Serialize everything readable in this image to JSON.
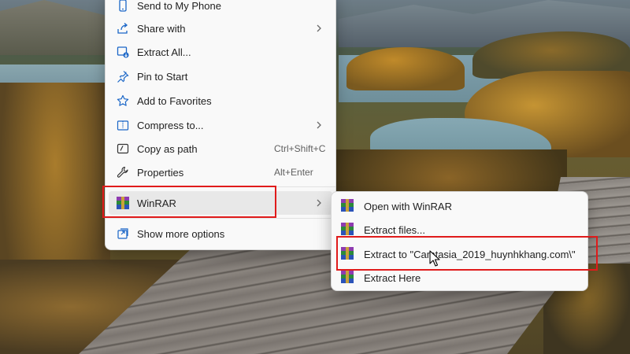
{
  "context_menu": {
    "items": [
      {
        "label": "Send to My Phone",
        "shortcut": "",
        "icon": "phone-icon"
      },
      {
        "label": "Share with",
        "shortcut": "",
        "icon": "share-icon",
        "submenu": true
      },
      {
        "label": "Extract All...",
        "shortcut": "",
        "icon": "extract-all-icon"
      },
      {
        "label": "Pin to Start",
        "shortcut": "",
        "icon": "pin-icon"
      },
      {
        "label": "Add to Favorites",
        "shortcut": "",
        "icon": "star-icon"
      },
      {
        "label": "Compress to...",
        "shortcut": "",
        "icon": "zip-folder-icon",
        "submenu": true
      },
      {
        "label": "Copy as path",
        "shortcut": "Ctrl+Shift+C",
        "icon": "copy-path-icon"
      },
      {
        "label": "Properties",
        "shortcut": "Alt+Enter",
        "icon": "wrench-icon"
      },
      {
        "label": "WinRAR",
        "shortcut": "",
        "icon": "winrar-icon",
        "submenu": true,
        "highlighted": true
      },
      {
        "label": "Show more options",
        "shortcut": "",
        "icon": "more-options-icon"
      }
    ]
  },
  "winrar_submenu": {
    "items": [
      {
        "label": "Open with WinRAR",
        "icon": "winrar-icon"
      },
      {
        "label": "Extract files...",
        "icon": "winrar-icon"
      },
      {
        "label": "Extract to \"Camtasia_2019_huynhkhang.com\\\"",
        "icon": "winrar-icon",
        "highlighted": true
      },
      {
        "label": "Extract Here",
        "icon": "winrar-icon"
      }
    ]
  },
  "colors": {
    "highlight_box": "#e01b1b",
    "menu_background": "#f9f9f9",
    "icon_blue": "#1a66c7"
  }
}
